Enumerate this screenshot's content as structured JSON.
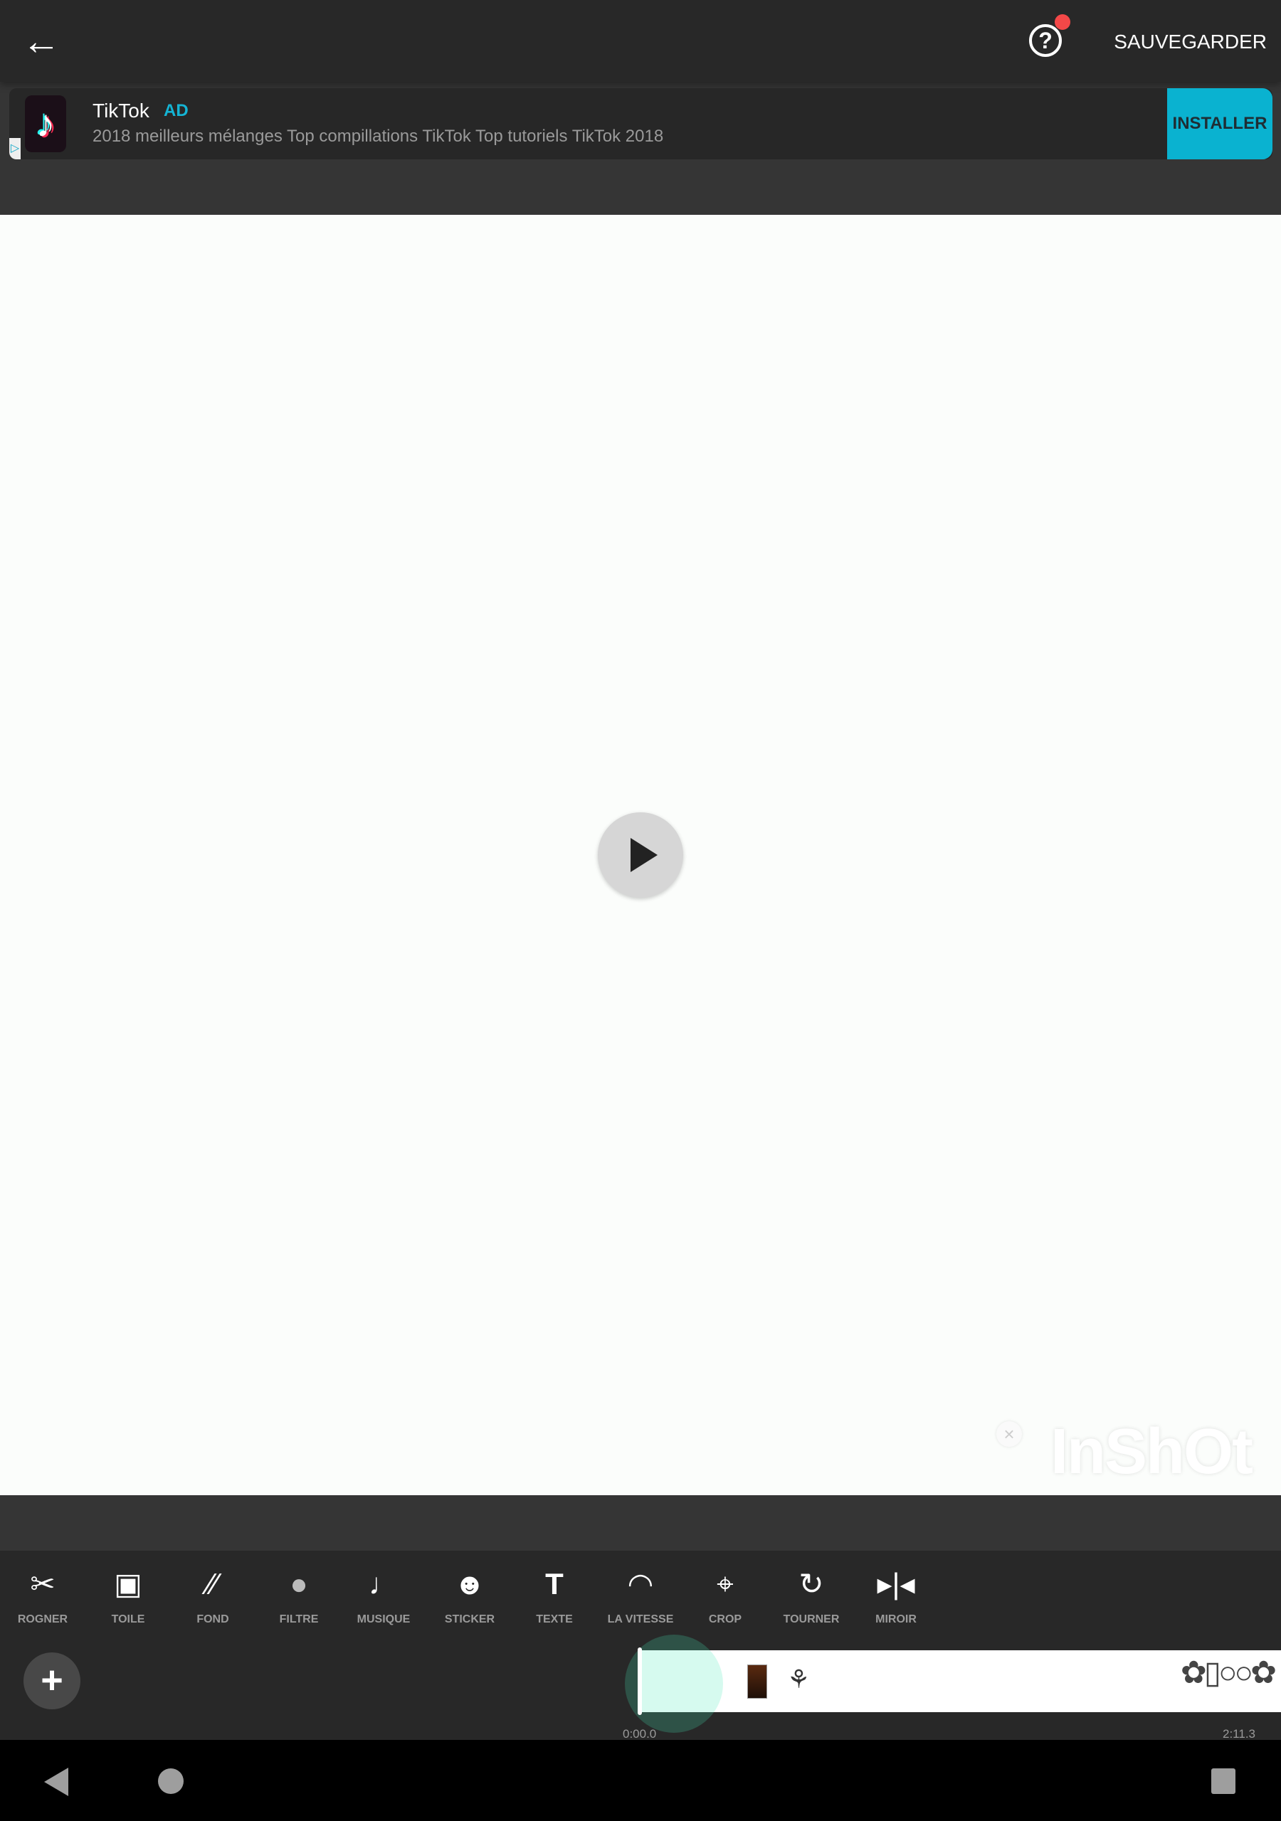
{
  "topbar": {
    "back_icon": "arrow-left-icon",
    "help_icon": "question-circle-icon",
    "save_label": "SAUVEGARDER",
    "notification_color": "#f44848"
  },
  "ad": {
    "title": "TikTok",
    "badge": "AD",
    "description": "2018 meilleurs mélanges Top compillations TikTok Top tutoriels TikTok 2018",
    "install_label": "INSTALLER",
    "accent": "#0ab2d0"
  },
  "preview": {
    "play_icon": "play-icon",
    "watermark": "InShOt",
    "watermark_close_icon": "close-icon"
  },
  "tools": [
    {
      "label": "ROGNER",
      "icon": "scissors-icon"
    },
    {
      "label": "TOILE",
      "icon": "canvas-icon"
    },
    {
      "label": "FOND",
      "icon": "background-icon"
    },
    {
      "label": "FILTRE",
      "icon": "filter-icon"
    },
    {
      "label": "MUSIQUE",
      "icon": "music-note-icon"
    },
    {
      "label": "STICKER",
      "icon": "smiley-icon"
    },
    {
      "label": "TEXTE",
      "icon": "text-icon"
    },
    {
      "label": "LA VITESSE",
      "icon": "speedometer-icon"
    },
    {
      "label": "CROP",
      "icon": "crop-icon"
    },
    {
      "label": "TOURNER",
      "icon": "rotate-icon"
    },
    {
      "label": "MIROIR",
      "icon": "mirror-icon"
    }
  ],
  "timeline": {
    "add_icon": "plus-icon",
    "start_time": "0:00.0",
    "end_time": "2:11.3"
  },
  "navbar": {
    "back": "nav-back-icon",
    "home": "nav-home-icon",
    "recents": "nav-recents-icon"
  }
}
